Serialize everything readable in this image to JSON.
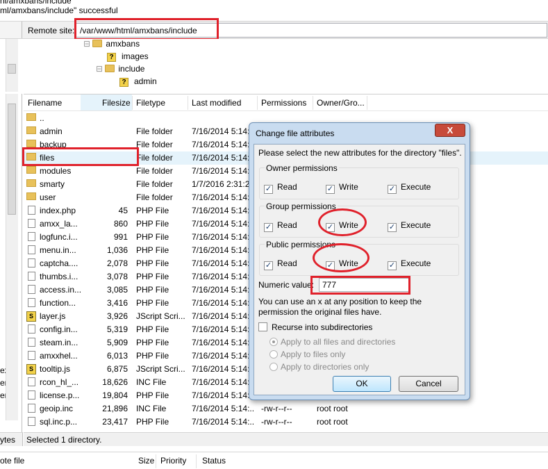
{
  "log": {
    "line1": "nl/amxbans/include",
    "line2": "ml/amxbans/include\" successful"
  },
  "remote": {
    "label": "Remote site:",
    "path": "/var/www/html/amxbans/include"
  },
  "tree": {
    "items": [
      {
        "name": "amxbans",
        "icon": "folder-icon"
      },
      {
        "name": "images",
        "icon": "unknown-folder-icon"
      },
      {
        "name": "include",
        "icon": "folder-icon"
      },
      {
        "name": "admin",
        "icon": "unknown-folder-icon"
      }
    ]
  },
  "columns": {
    "filename": "Filename",
    "filesize": "Filesize",
    "filetype": "Filetype",
    "modified": "Last modified",
    "permissions": "Permissions",
    "owner": "Owner/Gro..."
  },
  "files": [
    {
      "name": "..",
      "size": "",
      "type": "",
      "modified": "",
      "perms": "",
      "owner": "",
      "icon": "folder"
    },
    {
      "name": "admin",
      "size": "",
      "type": "File folder",
      "modified": "7/16/2014 5:14:...",
      "perms": "",
      "owner": "",
      "icon": "folder"
    },
    {
      "name": "backup",
      "size": "",
      "type": "File folder",
      "modified": "7/16/2014 5:14:...",
      "perms": "",
      "owner": "",
      "icon": "folder"
    },
    {
      "name": "files",
      "size": "",
      "type": "File folder",
      "modified": "7/16/2014 5:14:...",
      "perms": "",
      "owner": "",
      "icon": "folder"
    },
    {
      "name": "modules",
      "size": "",
      "type": "File folder",
      "modified": "7/16/2014 5:14:...",
      "perms": "",
      "owner": "",
      "icon": "folder"
    },
    {
      "name": "smarty",
      "size": "",
      "type": "File folder",
      "modified": "1/7/2016 2:31:2...",
      "perms": "",
      "owner": "",
      "icon": "folder"
    },
    {
      "name": "user",
      "size": "",
      "type": "File folder",
      "modified": "7/16/2014 5:14:...",
      "perms": "",
      "owner": "",
      "icon": "folder"
    },
    {
      "name": "index.php",
      "size": "45",
      "type": "PHP File",
      "modified": "7/16/2014 5:14:...",
      "perms": "",
      "owner": "",
      "icon": "file"
    },
    {
      "name": "amxx_la...",
      "size": "860",
      "type": "PHP File",
      "modified": "7/16/2014 5:14:...",
      "perms": "",
      "owner": "",
      "icon": "file"
    },
    {
      "name": "logfunc.i...",
      "size": "991",
      "type": "PHP File",
      "modified": "7/16/2014 5:14:...",
      "perms": "",
      "owner": "",
      "icon": "file"
    },
    {
      "name": "menu.in...",
      "size": "1,036",
      "type": "PHP File",
      "modified": "7/16/2014 5:14:...",
      "perms": "",
      "owner": "",
      "icon": "file"
    },
    {
      "name": "captcha....",
      "size": "2,078",
      "type": "PHP File",
      "modified": "7/16/2014 5:14:...",
      "perms": "",
      "owner": "",
      "icon": "file"
    },
    {
      "name": "thumbs.i...",
      "size": "3,078",
      "type": "PHP File",
      "modified": "7/16/2014 5:14:...",
      "perms": "",
      "owner": "",
      "icon": "file"
    },
    {
      "name": "access.in...",
      "size": "3,085",
      "type": "PHP File",
      "modified": "7/16/2014 5:14:...",
      "perms": "",
      "owner": "",
      "icon": "file"
    },
    {
      "name": "function...",
      "size": "3,416",
      "type": "PHP File",
      "modified": "7/16/2014 5:14:...",
      "perms": "",
      "owner": "",
      "icon": "file"
    },
    {
      "name": "layer.js",
      "size": "3,926",
      "type": "JScript Scri...",
      "modified": "7/16/2014 5:14:...",
      "perms": "",
      "owner": "",
      "icon": "js"
    },
    {
      "name": "config.in...",
      "size": "5,319",
      "type": "PHP File",
      "modified": "7/16/2014 5:14:...",
      "perms": "",
      "owner": "",
      "icon": "file"
    },
    {
      "name": "steam.in...",
      "size": "5,909",
      "type": "PHP File",
      "modified": "7/16/2014 5:14:...",
      "perms": "",
      "owner": "",
      "icon": "file"
    },
    {
      "name": "amxxhel...",
      "size": "6,013",
      "type": "PHP File",
      "modified": "7/16/2014 5:14:...",
      "perms": "",
      "owner": "",
      "icon": "file"
    },
    {
      "name": "tooltip.js",
      "size": "6,875",
      "type": "JScript Scri...",
      "modified": "7/16/2014 5:14:...",
      "perms": "",
      "owner": "",
      "icon": "js"
    },
    {
      "name": "rcon_hl_...",
      "size": "18,626",
      "type": "INC File",
      "modified": "7/16/2014 5:14:...",
      "perms": "",
      "owner": "",
      "icon": "file"
    },
    {
      "name": "license.p...",
      "size": "19,804",
      "type": "PHP File",
      "modified": "7/16/2014 5:14:...",
      "perms": "",
      "owner": "",
      "icon": "file"
    },
    {
      "name": "geoip.inc",
      "size": "21,896",
      "type": "INC File",
      "modified": "7/16/2014 5:14:...",
      "perms": "-rw-r--r--",
      "owner": "root root",
      "icon": "file"
    },
    {
      "name": "sql.inc.p...",
      "size": "23,417",
      "type": "PHP File",
      "modified": "7/16/2014 5:14:...",
      "perms": "-rw-r--r--",
      "owner": "root root",
      "icon": "file"
    }
  ],
  "left_side_fragments": [
    "ext",
    "ent",
    "ent",
    "ytes",
    "ote file"
  ],
  "status": {
    "text": "Selected 1 directory."
  },
  "queue": {
    "size": "Size",
    "priority": "Priority",
    "status": "Status"
  },
  "dialog": {
    "title": "Change file attributes",
    "close": "X",
    "intro": "Please select the new attributes for the directory \"files\".",
    "owner_title": "Owner permissions",
    "group_title": "Group permissions",
    "public_title": "Public permissions",
    "read": "Read",
    "write": "Write",
    "execute": "Execute",
    "numeric_label": "Numeric value:",
    "numeric_value": "777",
    "hint": "You can use an x at any position to keep the permission the original files have.",
    "recurse": "Recurse into subdirectories",
    "opt_all": "Apply to all files and directories",
    "opt_files": "Apply to files only",
    "opt_dirs": "Apply to directories only",
    "ok": "OK",
    "cancel": "Cancel"
  },
  "colors": {
    "highlight_red": "#e0212b",
    "folder": "#e8c15a",
    "dialog_frame": "#c9dcf0"
  }
}
